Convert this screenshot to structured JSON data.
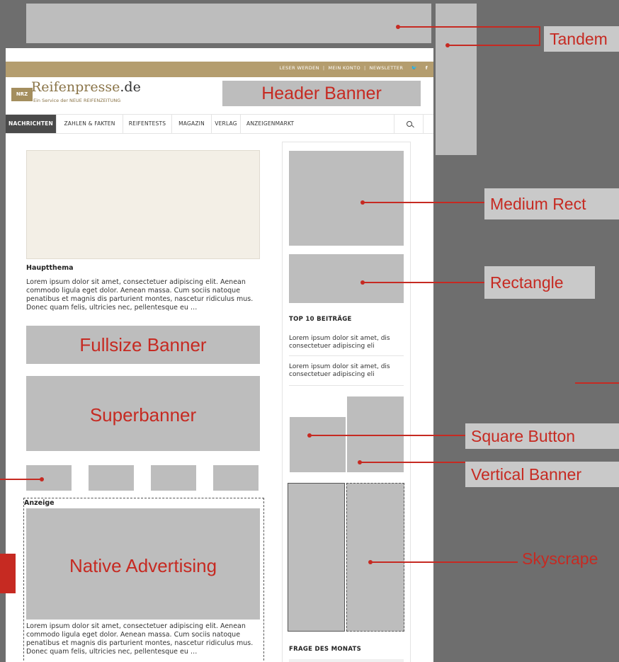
{
  "header": {
    "top_links": [
      "LESER WERDEN",
      "MEIN KONTO",
      "NEWSLETTER"
    ],
    "logo_mark": "NRZ",
    "logo_name": "Reifenpresse",
    "logo_tld": ".de",
    "logo_tagline": "Ein Service der NEUE REIFENZEITUNG"
  },
  "nav": {
    "items": [
      "NACHRICHTEN",
      "ZAHLEN & FAKTEN",
      "REIFENTESTS",
      "MAGAZIN",
      "VERLAG",
      "ANZEIGENMARKT"
    ]
  },
  "main": {
    "heading": "Hauptthema",
    "text": "Lorem ipsum dolor sit amet, consectetuer adipiscing elit. Aenean commodo ligula eget dolor. Aenean massa. Cum sociis natoque penatibus et magnis dis parturient montes, nascetur ridiculus mus. Donec quam felis, ultricies nec, pellentesque eu …",
    "ad_label": "Anzeige",
    "native_text": "Lorem ipsum dolor sit amet, consectetuer adipiscing elit. Aenean commodo ligula eget dolor. Aenean massa. Cum sociis natoque penatibus et magnis dis parturient montes, nascetur ridiculus mus. Donec quam felis, ultricies nec, pellentesque eu …"
  },
  "sidebar": {
    "top10_heading": "TOP 10 BEITRÄGE",
    "top10_items": [
      "Lorem ipsum dolor sit amet, dis consectetuer adipiscing eli",
      "Lorem ipsum dolor sit amet, dis consectetuer adipiscing eli"
    ],
    "poll_heading": "FRAGE DES MONATS"
  },
  "labels": {
    "tandem": "Tandem",
    "header_banner": "Header Banner",
    "medium_rectangle": "Medium Rect",
    "rectangle": "Rectangle",
    "fullsize_banner": "Fullsize Banner",
    "superbanner": "Superbanner",
    "square_button": "Square Button",
    "vertical_banner": "Vertical Banner",
    "native_advertising": "Native Advertising",
    "skyscraper": "Skyscrape"
  },
  "colors": {
    "accent_red": "#c62a22",
    "brand_gold": "#b49d6e",
    "placeholder_grey": "#bdbdbd"
  }
}
